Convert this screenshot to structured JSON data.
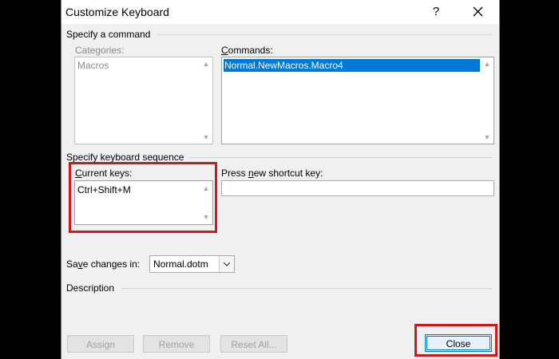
{
  "window": {
    "title": "Customize Keyboard",
    "help_glyph": "?"
  },
  "command_section": {
    "label": "Specify a command",
    "categories": {
      "label": "Categories:",
      "items": [
        "Macros"
      ]
    },
    "commands": {
      "label_underlined": "C",
      "label_rest": "ommands:",
      "items": [
        "Normal.NewMacros.Macro4"
      ],
      "selected_index": 0
    }
  },
  "keyboard_section": {
    "label": "Specify keyboard sequence",
    "current_keys": {
      "label_underlined": "C",
      "label_rest": "urrent keys:",
      "items": [
        "Ctrl+Shift+M"
      ]
    },
    "new_shortcut": {
      "label_pre": "Press ",
      "label_underlined": "n",
      "label_rest": "ew shortcut key:",
      "value": ""
    }
  },
  "save_changes": {
    "label_pre": "Sa",
    "label_underlined": "v",
    "label_rest": "e changes in:",
    "selected": "Normal.dotm"
  },
  "description": {
    "label": "Description"
  },
  "buttons": {
    "assign": "Assign",
    "remove": "Remove",
    "reset_all": "Reset All...",
    "close": "Close"
  },
  "colors": {
    "highlight": "#d11818",
    "selection": "#0078d7"
  }
}
